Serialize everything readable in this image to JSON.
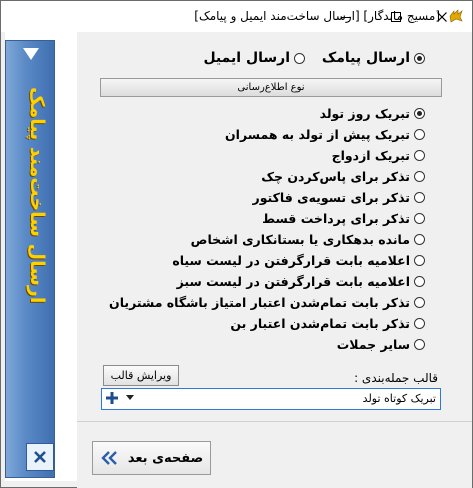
{
  "window": {
    "title": "[مسیج ماندگار] [ارسال ساخت‌مند ایمیل و پیامک]"
  },
  "sidebar": {
    "title": "ارسال ساخت‌مند پیامک"
  },
  "send_type": {
    "options": [
      {
        "label": "ارسال پیامک",
        "selected": true
      },
      {
        "label": "ارسال ایمیل",
        "selected": false
      }
    ]
  },
  "group_header": "نوع اطلاع‌رسانی",
  "notification_types": [
    {
      "label": "تبریک روز تولد",
      "selected": true
    },
    {
      "label": "تبریک پیش از تولد به همسران",
      "selected": false
    },
    {
      "label": "تبریک ازدواج",
      "selected": false
    },
    {
      "label": "تذکر برای پاس‌کردن چک",
      "selected": false
    },
    {
      "label": "تذکر برای تسویه‌ی فاکتور",
      "selected": false
    },
    {
      "label": "تذکر برای پرداخت قسط",
      "selected": false
    },
    {
      "label": "مانده بدهکاری یا بستانکاری اشخاص",
      "selected": false
    },
    {
      "label": "اعلامیه بابت قرارگرفتن در لیست سیاه",
      "selected": false
    },
    {
      "label": "اعلامیه بابت قرارگرفتن در لیست سبز",
      "selected": false
    },
    {
      "label": "تذکر بابت تمام‌شدن اعتبار امتیاز باشگاه مشتریان",
      "selected": false
    },
    {
      "label": "تذکر بابت تمام‌شدن اعتبار بن",
      "selected": false
    },
    {
      "label": "سایر جملات",
      "selected": false
    }
  ],
  "template": {
    "edit_button": "ویرایش قالب",
    "label": "قالب جمله‌بندی :",
    "value": "تبریک کوتاه تولد"
  },
  "footer": {
    "next_button": "صفحه‌ی بعد"
  },
  "colors": {
    "sidebar_blue": "#4a7bbd",
    "sidebar_title": "#ffd000",
    "focus_border": "#2f7ad6"
  }
}
